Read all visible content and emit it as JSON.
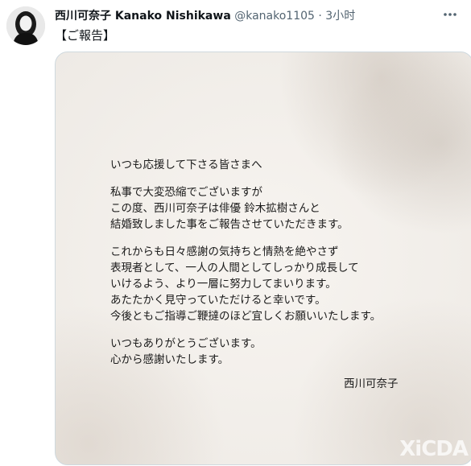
{
  "tweet": {
    "display_name": "西川可奈子 Kanako Nishikawa",
    "handle": "@kanako1105",
    "separator": "·",
    "time": "3小时",
    "text": "【ご報告】"
  },
  "letter": {
    "greeting": "いつも応援して下さる皆さまへ",
    "p1_l1": "私事で大変恐縮でございますが",
    "p1_l2": "この度、西川可奈子は俳優 鈴木拡樹さんと",
    "p1_l3": "結婚致しました事をご報告させていただきます。",
    "p2_l1": "これからも日々感謝の気持ちと情熱を絶やさず",
    "p2_l2": "表現者として、一人の人間としてしっかり成長して",
    "p2_l3": "いけるよう、より一層に努力してまいります。",
    "p2_l4": "あたたかく見守っていただけると幸いです。",
    "p2_l5": "今後ともご指導ご鞭撻のほど宜しくお願いいたします。",
    "p3_l1": "いつもありがとうございます。",
    "p3_l2": "心から感謝いたします。",
    "signature": "西川可奈子"
  },
  "watermark": "XiCDA",
  "icons": {
    "more": "more-horizontal-icon",
    "avatar": "profile-avatar"
  }
}
